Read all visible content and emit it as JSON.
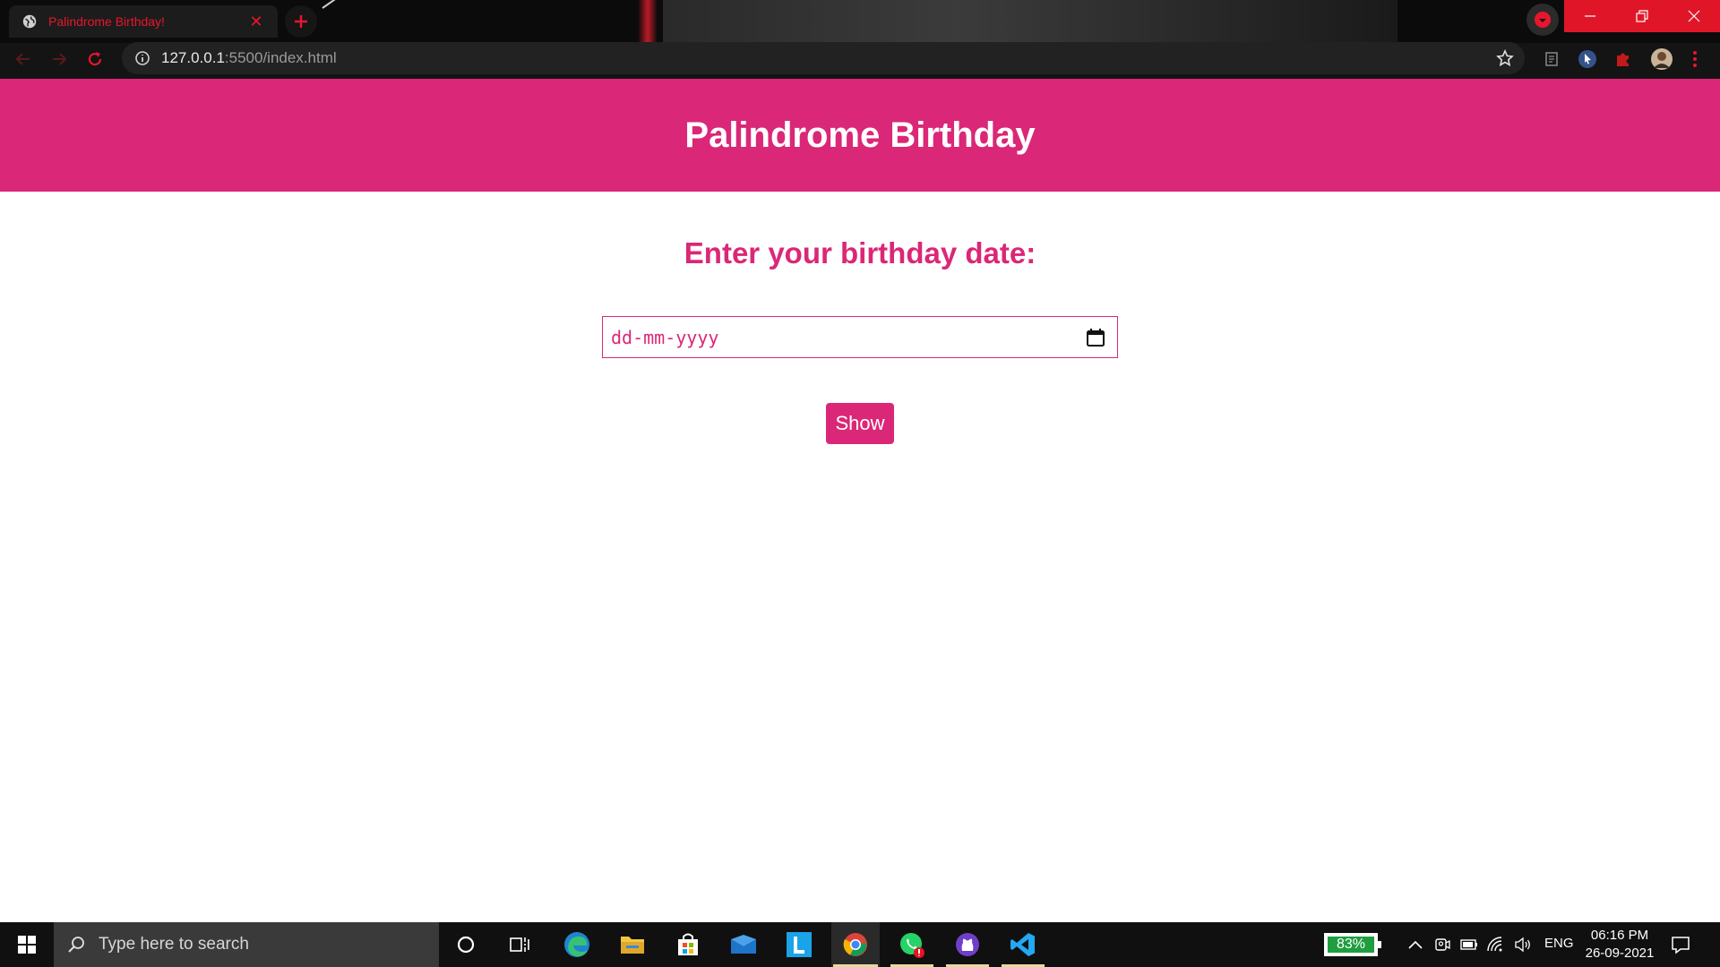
{
  "browser": {
    "tab_title": "Palindrome Birthday!",
    "url_host": "127.0.0.1",
    "url_rest": ":5500/index.html",
    "accent_color": "#e8162d"
  },
  "page": {
    "title": "Palindrome Birthday",
    "prompt": "Enter your birthday date:",
    "date_placeholder": "dd-mm-yyyy",
    "button_label": "Show",
    "brand_color": "#db2777"
  },
  "taskbar": {
    "search_placeholder": "Type here to search",
    "battery_percent": "83%",
    "language": "ENG",
    "time": "06:16 PM",
    "date": "26-09-2021",
    "apps": [
      "cortana-icon",
      "task-view-icon",
      "edge-icon",
      "file-explorer-icon",
      "store-icon",
      "mail-icon",
      "l-app-icon",
      "chrome-icon",
      "whatsapp-icon",
      "github-desktop-icon",
      "vscode-icon"
    ]
  }
}
